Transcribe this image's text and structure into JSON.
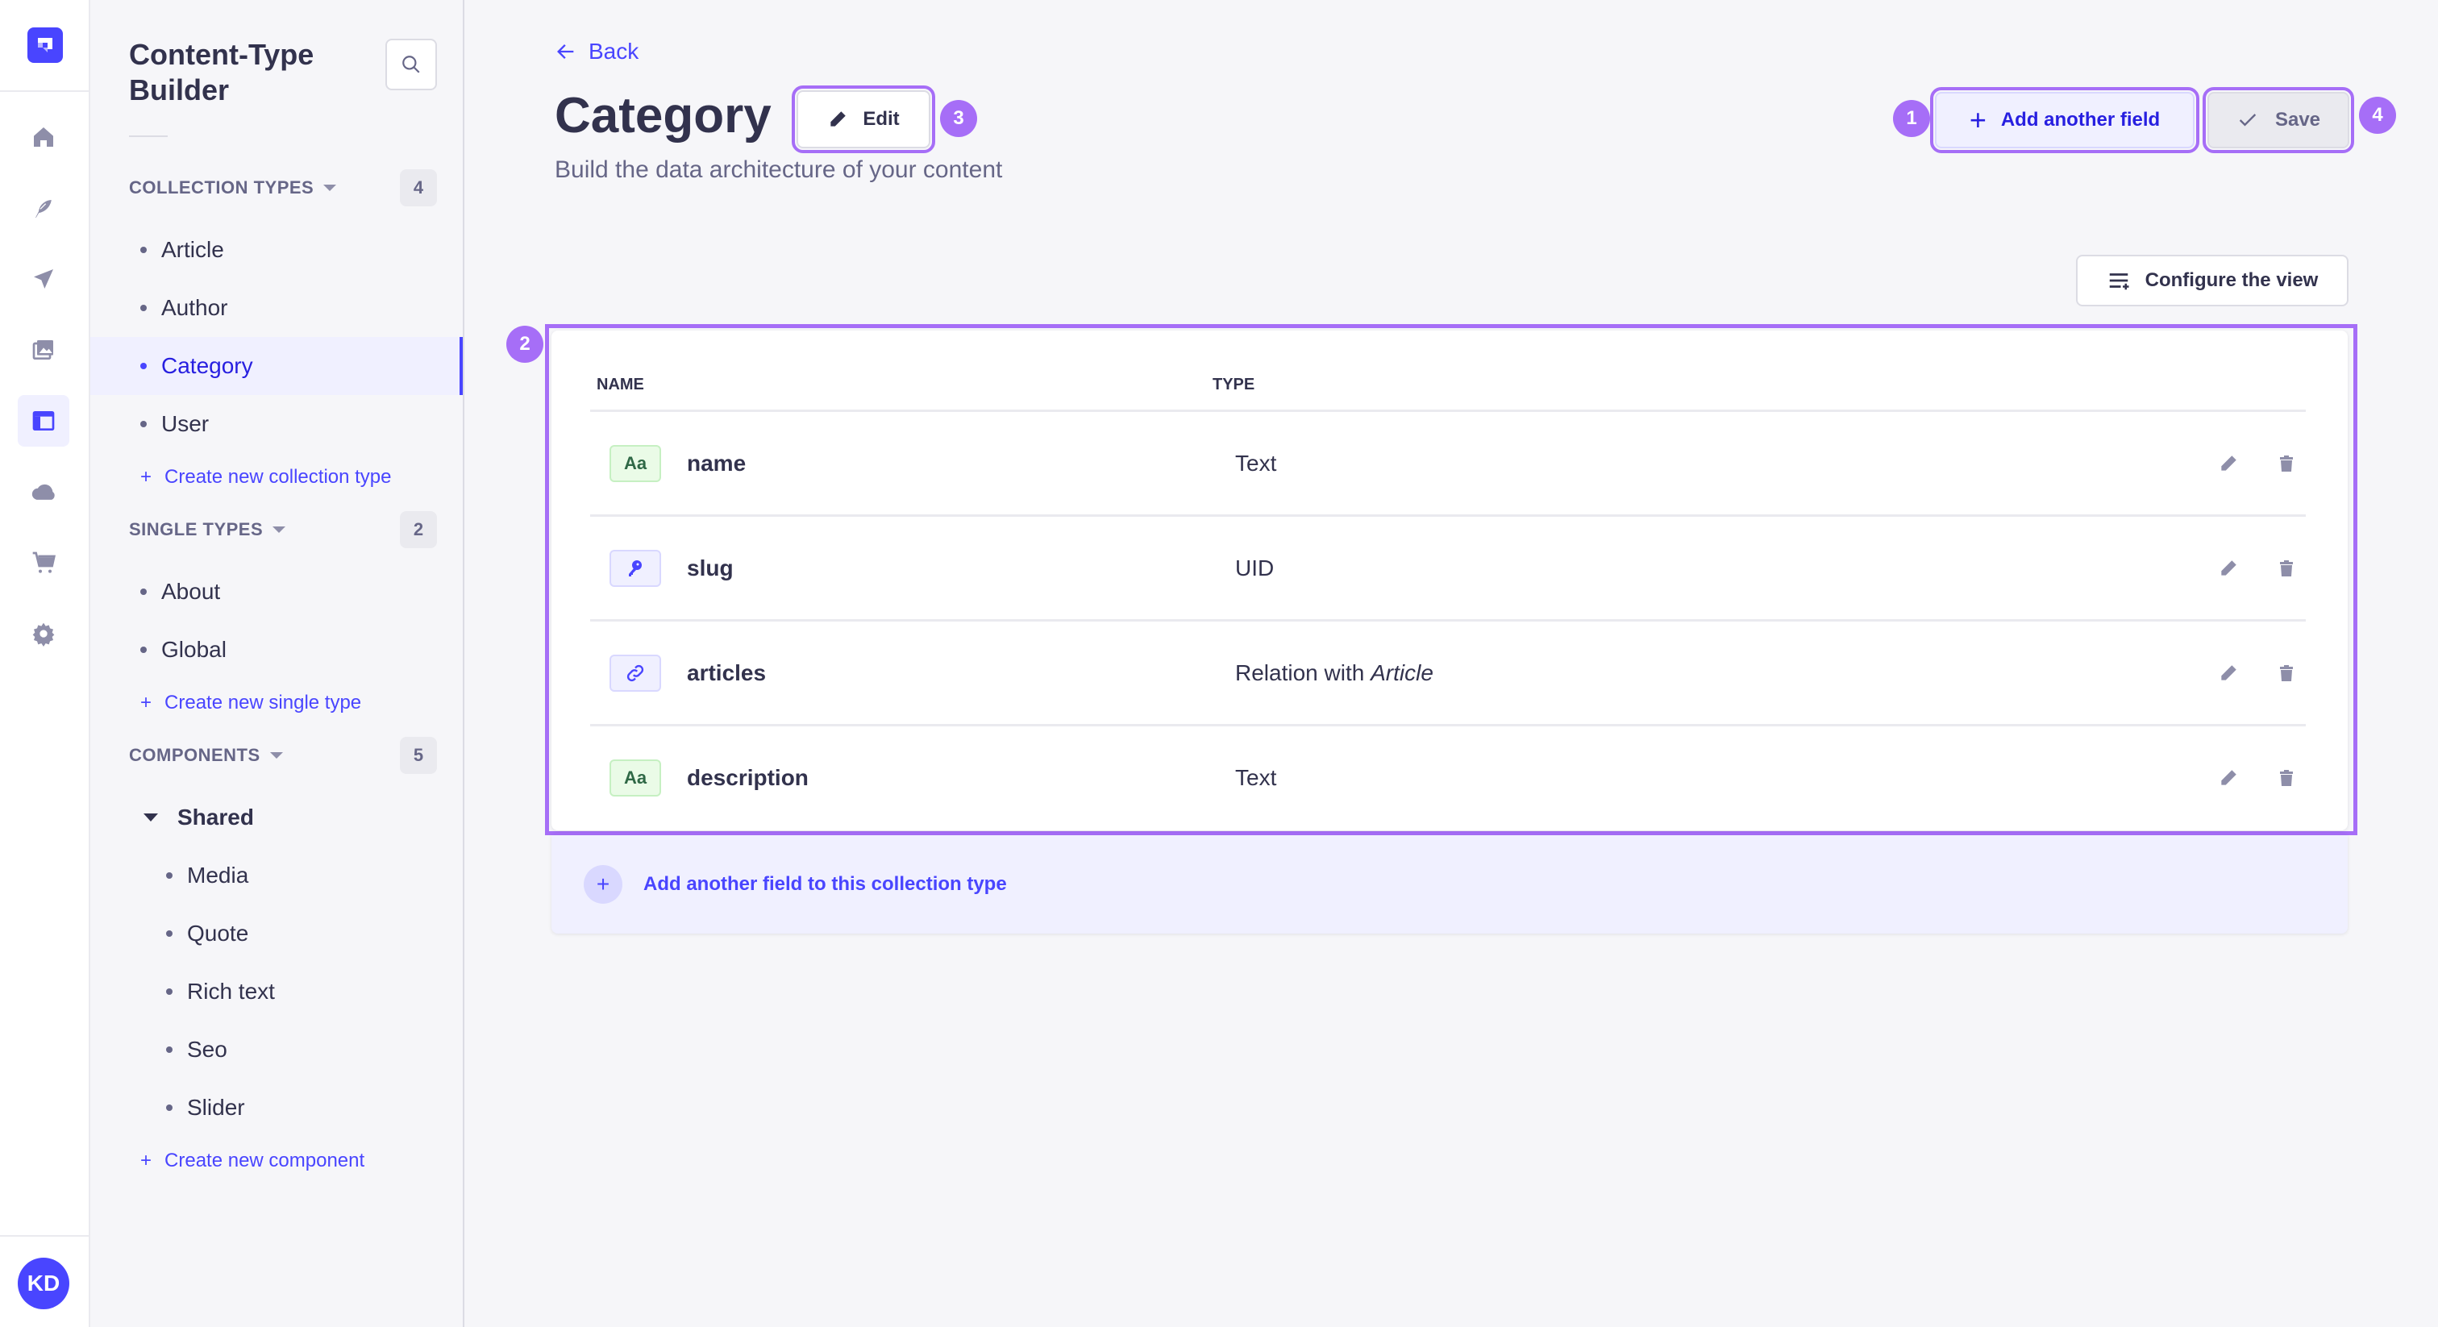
{
  "rail": {
    "logo": "strapi-logo-icon",
    "items": [
      {
        "icon": "home-icon"
      },
      {
        "icon": "feather-icon"
      },
      {
        "icon": "paper-plane-icon"
      },
      {
        "icon": "media-library-icon"
      },
      {
        "icon": "layout-icon",
        "active": true
      },
      {
        "icon": "cloud-icon"
      },
      {
        "icon": "cart-icon"
      },
      {
        "icon": "gear-icon"
      }
    ],
    "avatar_initials": "KD"
  },
  "subnav": {
    "title": "Content-Type Builder",
    "sections": [
      {
        "label": "COLLECTION TYPES",
        "count": "4",
        "items": [
          "Article",
          "Author",
          "Category",
          "User"
        ],
        "active": "Category",
        "create_label": "Create new collection type"
      },
      {
        "label": "SINGLE TYPES",
        "count": "2",
        "items": [
          "About",
          "Global"
        ],
        "create_label": "Create new single type"
      },
      {
        "label": "COMPONENTS",
        "count": "5",
        "group": "Shared",
        "items": [
          "Media",
          "Quote",
          "Rich text",
          "Seo",
          "Slider"
        ],
        "create_label": "Create new component"
      }
    ]
  },
  "header": {
    "back_label": "Back",
    "title": "Category",
    "edit_label": "Edit",
    "subtitle": "Build the data architecture of your content",
    "add_field_label": "Add another field",
    "save_label": "Save",
    "configure_label": "Configure the view"
  },
  "markers": [
    "1",
    "2",
    "3",
    "4"
  ],
  "table": {
    "columns": [
      "NAME",
      "TYPE"
    ],
    "rows": [
      {
        "name": "name",
        "type": "Text",
        "icon": "text-icon",
        "icon_text": "Aa"
      },
      {
        "name": "slug",
        "type": "UID",
        "icon": "key-icon"
      },
      {
        "name": "articles",
        "type_prefix": "Relation with ",
        "type_target": "Article",
        "icon": "link-icon"
      },
      {
        "name": "description",
        "type": "Text",
        "icon": "text-icon",
        "icon_text": "Aa"
      }
    ],
    "add_row_label": "Add another field to this collection type"
  },
  "colors": {
    "primary": "#4945ff",
    "annotation": "#a66ef7",
    "background": "#f6f6f9"
  }
}
